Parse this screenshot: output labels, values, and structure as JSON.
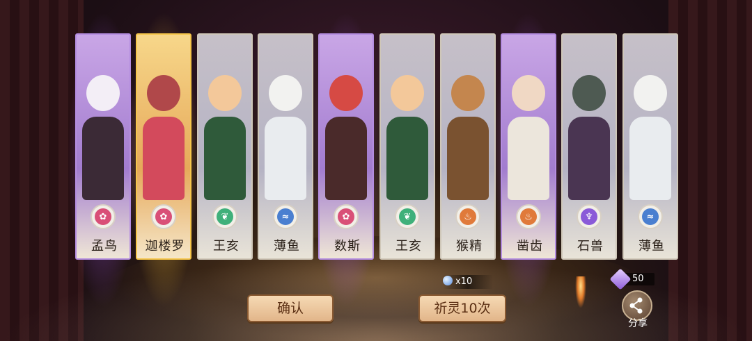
{
  "cards": [
    {
      "name": "孟鸟",
      "rarity": "purple",
      "faction_icon": "flower-cloud-icon",
      "faction_color": "#d94f77",
      "art_colors": [
        "#f3eef6",
        "#3b2a36"
      ]
    },
    {
      "name": "迦楼罗",
      "rarity": "gold",
      "faction_icon": "flower-cloud-icon",
      "faction_color": "#d94f77",
      "art_colors": [
        "#b0484a",
        "#d34a5c"
      ]
    },
    {
      "name": "王亥",
      "rarity": "normal",
      "faction_icon": "leaf-crest-icon",
      "faction_color": "#3fb07a",
      "art_colors": [
        "#f3c89a",
        "#2f5a3a"
      ]
    },
    {
      "name": "薄鱼",
      "rarity": "normal",
      "faction_icon": "wave-icon",
      "faction_color": "#4a7fd0",
      "art_colors": [
        "#f2f2f0",
        "#e9ecef"
      ]
    },
    {
      "name": "数斯",
      "rarity": "purple",
      "faction_icon": "flower-cloud-icon",
      "faction_color": "#d94f77",
      "art_colors": [
        "#d64a44",
        "#4a2a2a"
      ]
    },
    {
      "name": "王亥",
      "rarity": "normal",
      "faction_icon": "leaf-crest-icon",
      "faction_color": "#3fb07a",
      "art_colors": [
        "#f3c89a",
        "#2f5a3a"
      ]
    },
    {
      "name": "猴精",
      "rarity": "normal",
      "faction_icon": "flame-crest-icon",
      "faction_color": "#e07a3a",
      "art_colors": [
        "#c4864e",
        "#7a5230"
      ]
    },
    {
      "name": "凿齿",
      "rarity": "purple",
      "faction_icon": "flame-crest-icon",
      "faction_color": "#e07a3a",
      "art_colors": [
        "#f0d8c4",
        "#ece6dc"
      ]
    },
    {
      "name": "石兽",
      "rarity": "normal",
      "faction_icon": "purple-flame-icon",
      "faction_color": "#8a5ad8",
      "art_colors": [
        "#4e5a52",
        "#4a3552"
      ]
    },
    {
      "name": "薄鱼",
      "rarity": "normal",
      "faction_icon": "wave-icon",
      "faction_color": "#4a7fd0",
      "art_colors": [
        "#f2f2f0",
        "#e9ecef"
      ]
    }
  ],
  "buttons": {
    "confirm_label": "确认",
    "summon_label": "祈灵10次"
  },
  "cost": {
    "text": "x10",
    "icon": "spirit-orb-icon"
  },
  "currency": {
    "value": "50",
    "icon": "purple-gem-icon"
  },
  "share": {
    "label": "分享",
    "icon": "share-icon"
  }
}
